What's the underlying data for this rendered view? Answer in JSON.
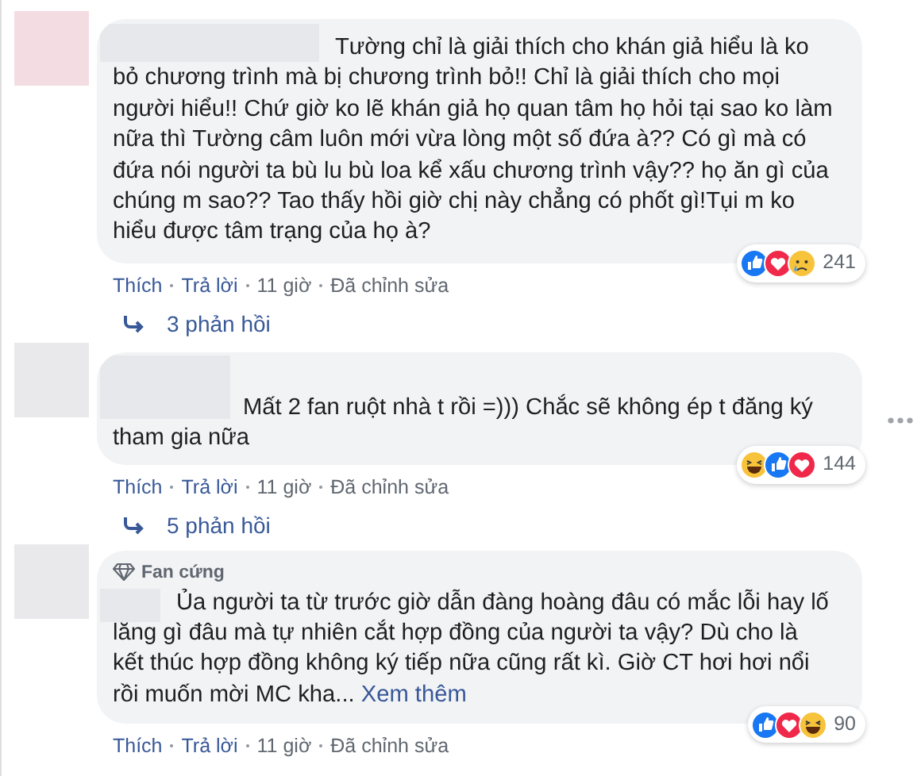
{
  "comments": [
    {
      "text": "Tường chỉ là giải thích cho khán giả hiểu là ko bỏ chương trình mà bị chương trình bỏ!! Chỉ là giải thích cho mọi người hiểu!! Chứ giờ ko lẽ khán giả họ quan tâm họ hỏi tại sao ko làm nữa thì Tường câm luôn mới vừa lòng một số đứa à?? Có gì mà có đứa nói người ta bù lu bù loa kể xấu chương trình vậy?? họ ăn gì của chúng m sao?? Tao thấy hồi giờ chị này chẳng có phốt gì!Tụi m ko hiểu được tâm trạng của họ à?",
      "more_menu": false,
      "reactions": [
        {
          "kind": "like"
        },
        {
          "kind": "love"
        },
        {
          "kind": "sad"
        }
      ],
      "reaction_count": "241",
      "actions": [
        "Thích",
        "Trả lời",
        "11 giờ",
        "Đã chỉnh sửa"
      ],
      "replies": "3 phản hồi"
    },
    {
      "text": "Mất 2 fan ruột nhà t rồi =))) Chắc sẽ không ép t đăng ký tham gia nữa",
      "more_menu": true,
      "reactions": [
        {
          "kind": "haha"
        },
        {
          "kind": "like"
        },
        {
          "kind": "love"
        }
      ],
      "reaction_count": "144",
      "actions": [
        "Thích",
        "Trả lời",
        "11 giờ",
        "Đã chỉnh sửa"
      ],
      "replies": "5 phản hồi"
    },
    {
      "badge": "Fan cứng",
      "text": "Ủa người ta từ trước giờ dẫn đàng hoàng đâu có mắc lỗi hay lố lăng gì đâu mà tự nhiên cắt hợp đồng của người ta vậy? Dù cho là kết thúc hợp đồng không ký tiếp nữa cũng rất kì. Giờ CT hơi hơi nổi rồi muốn mời MC kha...",
      "see_more": "Xem thêm",
      "more_menu": false,
      "reactions": [
        {
          "kind": "like"
        },
        {
          "kind": "love"
        },
        {
          "kind": "haha"
        }
      ],
      "reaction_count": "90",
      "actions": [
        "Thích",
        "Trả lời",
        "11 giờ",
        "Đã chỉnh sửa"
      ]
    }
  ]
}
